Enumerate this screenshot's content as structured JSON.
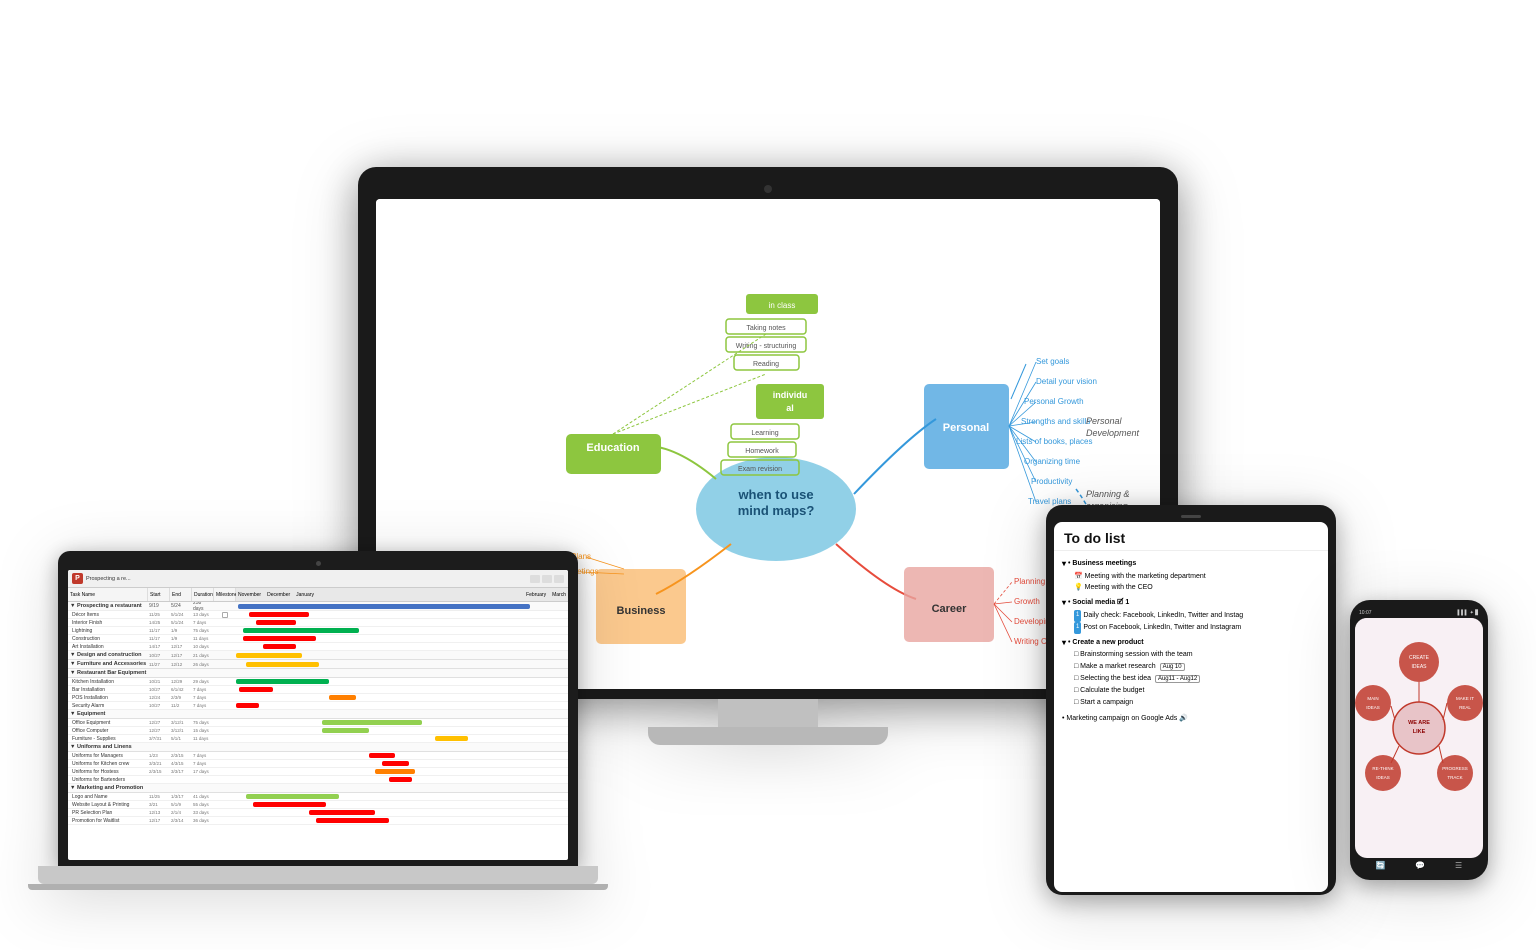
{
  "scene": {
    "background": "#ffffff"
  },
  "monitor": {
    "mindmap": {
      "center_label": "when to use\nmind maps?",
      "nodes": [
        {
          "id": "education",
          "label": "Education",
          "color": "#8DC63F",
          "subnodes": [
            "in class",
            "individu al",
            "Learning",
            "Homework",
            "Exam revision",
            "Taking notes",
            "Writing - structuring",
            "Reading"
          ]
        },
        {
          "id": "personal",
          "label": "Personal",
          "color": "#F7941D",
          "subnodes": [
            "Set goals",
            "Detail your vision",
            "Personal Growth",
            "Strengths and skills",
            "Lists of books, places",
            "Organizing time",
            "Productivity",
            "Travel plans"
          ]
        },
        {
          "id": "business",
          "label": "Business",
          "color": "#F7941D",
          "subnodes": [
            "Plans",
            "Meetings"
          ]
        },
        {
          "id": "career",
          "label": "Career",
          "color": "#E8837A",
          "subnodes": [
            "Planning career goals",
            "Growth",
            "Developing new skills",
            "Writing CV/Cover letter"
          ]
        }
      ],
      "group_labels": [
        "Personal Development",
        "Planning & organising"
      ]
    }
  },
  "laptop": {
    "title": "Prospecting a re...",
    "app_letter": "P",
    "columns": [
      "Task Name",
      "Start",
      "End",
      "Duration",
      "Milestone"
    ],
    "categories": [
      "Prospecting a restaurant",
      "Décor Items",
      "Interior Finish",
      "Lightning",
      "Construction",
      "Art Installation",
      "Design and construction",
      "Furniture and Accessories",
      "Restaurant Bar Equipment",
      "Kitchen Installation",
      "Bar Installation",
      "POS Installation",
      "Security Alarm",
      "Equipment",
      "Office Equipment",
      "Office Computer",
      "Furniture - Supplies",
      "Uniforms and Linens",
      "Uniforms for Managers",
      "Uniforms for Kitchen crew",
      "Uniforms for Hostess",
      "Uniforms for Bartenders",
      "Marketing and Promotion",
      "Logo and Name",
      "Website Layout & Printing",
      "PR Selection Plan",
      "Promotion for Waitlist"
    ],
    "bar_colors": [
      "#4472C4",
      "#FF0000",
      "#00B050",
      "#FF0000",
      "#FF0000",
      "#FF0000",
      "#FFC000",
      "#FFC000",
      "#FFC000",
      "#00B050",
      "#FF0000",
      "#FF7F00",
      "#FF0000",
      "#92D050",
      "#92D050",
      "#92D050",
      "#FFC000",
      "#FF0000",
      "#FF0000",
      "#FF0000",
      "#FF7F00",
      "#FF0000",
      "#FF0000",
      "#92D050",
      "#FF0000",
      "#FF0000"
    ]
  },
  "tablet": {
    "title": "To do list",
    "sections": [
      {
        "name": "Business meetings",
        "items": [
          {
            "icon": "📅",
            "text": "Meeting with the marketing department"
          },
          {
            "icon": "💡",
            "text": "Meeting with the CEO"
          }
        ]
      },
      {
        "name": "Social media 🗹 1",
        "items": [
          {
            "icon": "1",
            "text": "Daily check: Facebook, LinkedIn, Twitter and Instag",
            "tag": null
          },
          {
            "icon": "1",
            "text": "Post on Facebook, LinkedIn, Twitter and Instagram",
            "tag": null
          }
        ]
      },
      {
        "name": "Create a new product",
        "items": [
          {
            "icon": "□",
            "text": "Brainstorming session with the team"
          },
          {
            "icon": "□",
            "text": "Make a market research",
            "tag": "Aug 10"
          },
          {
            "icon": "□",
            "text": "Selecting the best idea",
            "tag": "Aug11 - Aug12"
          },
          {
            "icon": "□",
            "text": "Calculate the budget"
          },
          {
            "icon": "□",
            "text": "Start a campaign"
          }
        ]
      }
    ],
    "footer": "Marketing campaign on Google Ads 🔊"
  },
  "phone": {
    "status_bar": "10:07",
    "circles": [
      {
        "label": "CREATE\nIDEAS",
        "color": "#c0392b"
      },
      {
        "label": "MAKE IT\nREAL",
        "color": "#c0392b"
      },
      {
        "label": "PROGRESS\nTRACK",
        "color": "#c0392b"
      },
      {
        "label": "RE-THINK\nIDEAS",
        "color": "#c0392b"
      },
      {
        "label": "MAIN\nIDEAS",
        "color": "#e8d5d5"
      }
    ],
    "bottom_icons": [
      "🔄",
      "💬",
      "☰"
    ]
  }
}
